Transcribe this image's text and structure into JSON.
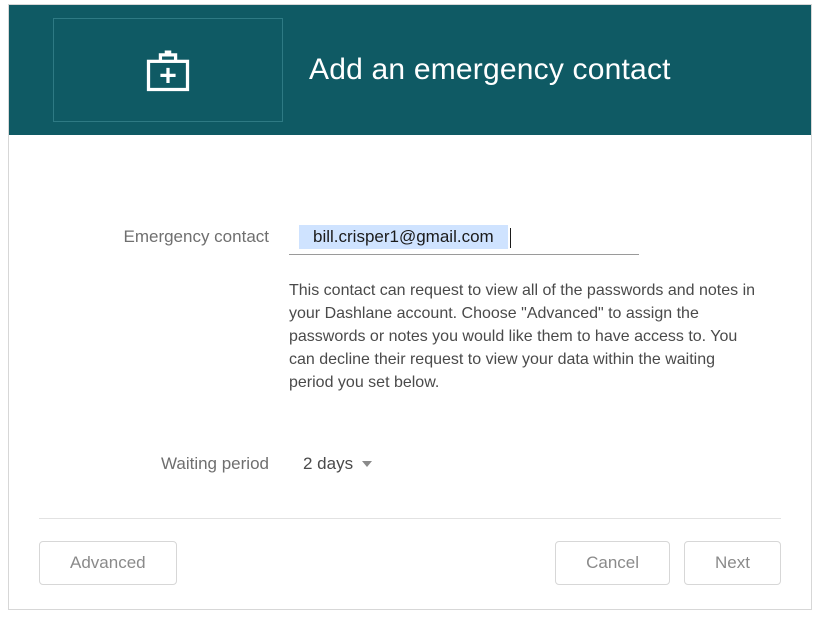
{
  "header": {
    "title": "Add an emergency contact"
  },
  "form": {
    "contact_label": "Emergency contact",
    "contact_value": "bill.crisper1@gmail.com",
    "description": "This contact can request to view all of the passwords and notes in your Dashlane account. Choose \"Advanced\" to assign the passwords or notes you would like them to have access to. You can decline their request to view your data within the waiting period you set below.",
    "waiting_label": "Waiting period",
    "waiting_value": "2 days"
  },
  "footer": {
    "advanced": "Advanced",
    "cancel": "Cancel",
    "next": "Next"
  }
}
